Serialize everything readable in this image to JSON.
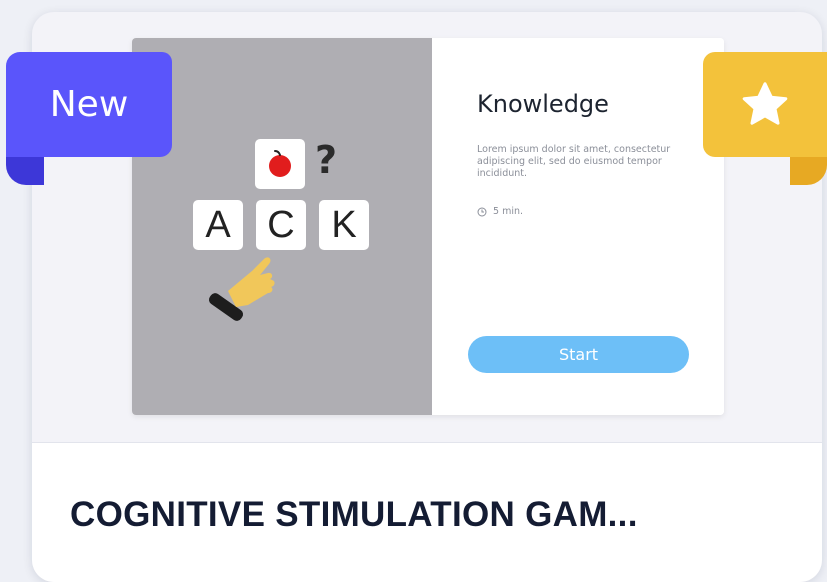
{
  "badges": {
    "new_label": "New",
    "favorite_icon": "star-icon"
  },
  "preview": {
    "puzzle_letters": [
      "A",
      "C",
      "K"
    ],
    "question_mark": "?",
    "game_title": "Knowledge",
    "game_description": "Lorem ipsum dolor sit amet, consectetur adipiscing elit, sed do eiusmod tempor incididunt.",
    "duration": "5 min.",
    "start_label": "Start"
  },
  "card": {
    "title": "COGNITIVE STIMULATION GAM..."
  },
  "colors": {
    "new_badge": "#5a55fb",
    "star_badge": "#f3c23b",
    "start_button": "#6dbff7",
    "preview_left_bg": "#afaeb3"
  }
}
